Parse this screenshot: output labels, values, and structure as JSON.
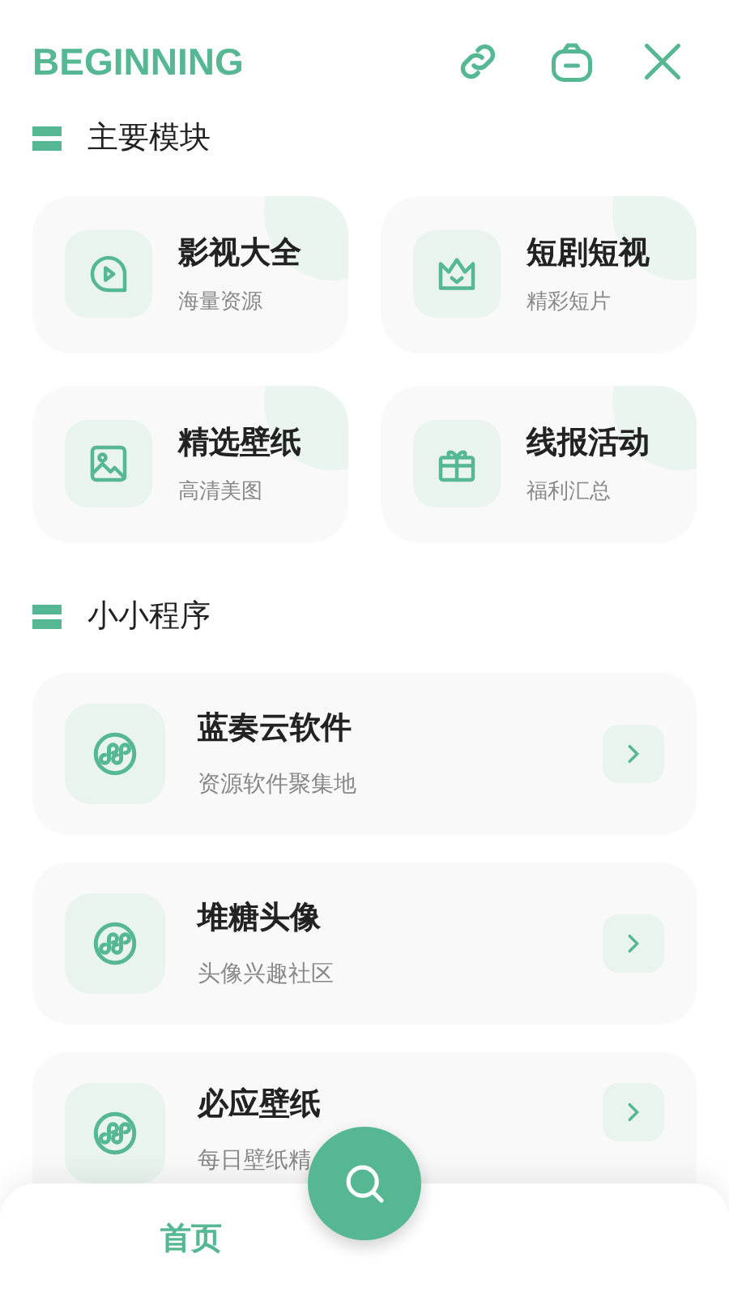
{
  "header": {
    "title": "BEGINNING"
  },
  "main_section": {
    "title": "主要模块",
    "modules": [
      {
        "title": "影视大全",
        "subtitle": "海量资源",
        "kind": "play"
      },
      {
        "title": "短剧短视",
        "subtitle": "精彩短片",
        "kind": "crown"
      },
      {
        "title": "精选壁纸",
        "subtitle": "高清美图",
        "kind": "image"
      },
      {
        "title": "线报活动",
        "subtitle": "福利汇总",
        "kind": "gift"
      }
    ]
  },
  "mini_section": {
    "title": "小小程序",
    "apps": [
      {
        "title": "蓝奏云软件",
        "subtitle": "资源软件聚集地"
      },
      {
        "title": "堆糖头像",
        "subtitle": "头像兴趣社区"
      },
      {
        "title": "必应壁纸",
        "subtitle": "每日壁纸精"
      }
    ]
  },
  "bottom_nav": {
    "tabs": [
      {
        "label": "首页",
        "selected": true
      }
    ]
  }
}
